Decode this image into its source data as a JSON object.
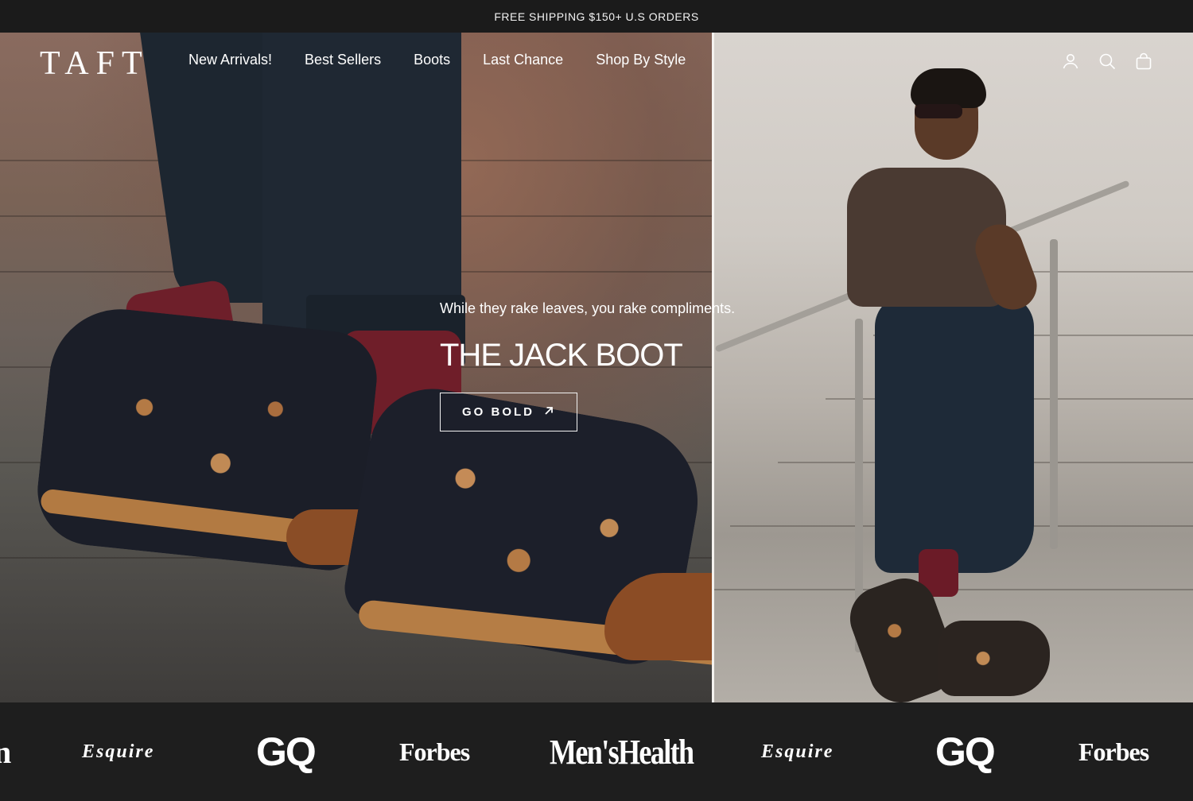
{
  "announcement": "FREE SHIPPING $150+ U.S ORDERS",
  "header": {
    "logo": "TAFT",
    "nav": [
      "New Arrivals!",
      "Best Sellers",
      "Boots",
      "Last Chance",
      "Shop By Style"
    ],
    "icons": [
      "account-icon",
      "search-icon",
      "cart-icon"
    ]
  },
  "hero": {
    "tagline": "While they rake leaves, you rake compliments.",
    "headline": "THE JACK BOOT",
    "cta_label": "GO BOLD",
    "cta_icon": "arrow-up-right-icon"
  },
  "press": {
    "logos": [
      "Esquire",
      "GQ",
      "Forbes",
      "Men'sHealth",
      "Esquire",
      "GQ",
      "Forbes"
    ],
    "partial_left_fragment": "n"
  },
  "colors": {
    "bar": "#1b1b1b",
    "sock": "#6e1f2a",
    "boot_leather": "#8b4c25"
  }
}
